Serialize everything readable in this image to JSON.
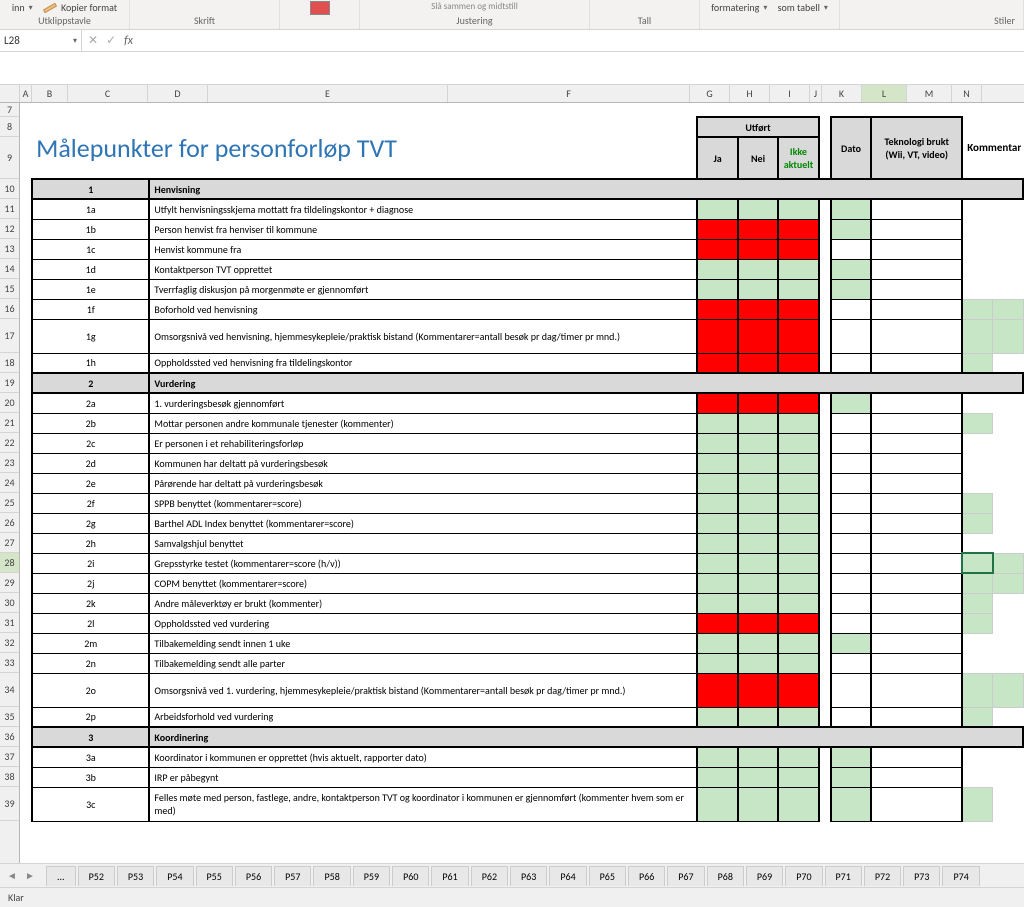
{
  "ribbon": {
    "copy_format": "Kopier format",
    "inn": "inn",
    "clipboard": "Utklippstavle",
    "font": "Skrift",
    "alignment": "Justering",
    "number": "Tall",
    "cond_format": "formatering",
    "as_table": "som tabell",
    "styles": "Stiler",
    "merge_center": "Slå sammen og midtstill"
  },
  "namebox": "L28",
  "columns": [
    "A",
    "B",
    "C",
    "D",
    "E",
    "F",
    "G",
    "H",
    "I",
    "J",
    "K",
    "L",
    "M",
    "N"
  ],
  "row_nums": [
    "7",
    "8",
    "9",
    "10",
    "11",
    "12",
    "13",
    "14",
    "15",
    "16",
    "17",
    "18",
    "19",
    "20",
    "21",
    "22",
    "23",
    "24",
    "25",
    "26",
    "27",
    "28",
    "29",
    "30",
    "31",
    "32",
    "33",
    "34",
    "35",
    "36",
    "37",
    "38",
    "39"
  ],
  "title": "Målepunkter for personforløp TVT",
  "headers": {
    "utfort": "Utført",
    "ja": "Ja",
    "nei": "Nei",
    "ikke": "Ikke aktuelt",
    "dato": "Dato",
    "teknologi": "Teknologi brukt (Wii, VT, video)",
    "kommentar": "Kommentar"
  },
  "sec1": {
    "num": "1",
    "title": "Henvisning"
  },
  "r1a": {
    "id": "1a",
    "txt": "Utfylt henvisningsskjema mottatt fra tildelingskontor + diagnose"
  },
  "r1b": {
    "id": "1b",
    "txt": "Person henvist fra henviser til kommune"
  },
  "r1c": {
    "id": "1c",
    "txt": "Henvist kommune fra"
  },
  "r1d": {
    "id": "1d",
    "txt": "Kontaktperson TVT opprettet"
  },
  "r1e": {
    "id": "1e",
    "txt": "Tverrfaglig diskusjon på morgenmøte er gjennomført"
  },
  "r1f": {
    "id": "1f",
    "txt": "Boforhold ved henvisning"
  },
  "r1g": {
    "id": "1g",
    "txt": "Omsorgsnivå ved henvisning, hjemmesykepleie/praktisk bistand (Kommentarer=antall besøk pr dag/timer pr mnd.)"
  },
  "r1h": {
    "id": "1h",
    "txt": "Oppholdssted ved henvisning fra tildelingskontor"
  },
  "sec2": {
    "num": "2",
    "title": "Vurdering"
  },
  "r2a": {
    "id": "2a",
    "txt": "1. vurderingsbesøk gjennomført"
  },
  "r2b": {
    "id": "2b",
    "txt": "Mottar personen andre kommunale tjenester (kommenter)"
  },
  "r2c": {
    "id": "2c",
    "txt": "Er personen i et rehabiliteringsforløp"
  },
  "r2d": {
    "id": "2d",
    "txt": "Kommunen har deltatt på vurderingsbesøk"
  },
  "r2e": {
    "id": "2e",
    "txt": "Pårørende har deltatt på vurderingsbesøk"
  },
  "r2f": {
    "id": "2f",
    "txt": "SPPB benyttet (kommentarer=score)"
  },
  "r2g": {
    "id": "2g",
    "txt": "Barthel ADL Index benyttet (kommentarer=score)"
  },
  "r2h": {
    "id": "2h",
    "txt": "Samvalgshjul benyttet"
  },
  "r2i": {
    "id": "2i",
    "txt": "Grepsstyrke testet (kommentarer=score (h/v))"
  },
  "r2j": {
    "id": "2j",
    "txt": "COPM benyttet (kommentarer=score)"
  },
  "r2k": {
    "id": "2k",
    "txt": "Andre måleverktøy er brukt (kommenter)"
  },
  "r2l": {
    "id": "2l",
    "txt": "Oppholdssted ved vurdering"
  },
  "r2m": {
    "id": "2m",
    "txt": "Tilbakemelding sendt innen 1 uke"
  },
  "r2n": {
    "id": "2n",
    "txt": "Tilbakemelding sendt alle parter"
  },
  "r2o": {
    "id": "2o",
    "txt": "Omsorgsnivå ved 1. vurdering, hjemmesykepleie/praktisk bistand (Kommentarer=antall besøk pr dag/timer pr mnd.)"
  },
  "r2p": {
    "id": "2p",
    "txt": "Arbeidsforhold ved vurdering"
  },
  "sec3": {
    "num": "3",
    "title": "Koordinering"
  },
  "r3a": {
    "id": "3a",
    "txt": "Koordinator i kommunen er opprettet (hvis aktuelt, rapporter dato)"
  },
  "r3b": {
    "id": "3b",
    "txt": "IRP er påbegynt"
  },
  "r3c": {
    "id": "3c",
    "txt": "Felles møte med person, fastlege, andre, kontaktperson TVT og koordinator i kommunen er gjennomført (kommenter hvem som er med)"
  },
  "tabs": [
    "P52",
    "P53",
    "P54",
    "P55",
    "P56",
    "P57",
    "P58",
    "P59",
    "P60",
    "P61",
    "P62",
    "P63",
    "P64",
    "P65",
    "P66",
    "P67",
    "P68",
    "P69",
    "P70",
    "P71",
    "P72",
    "P73",
    "P74"
  ],
  "status": "Klar",
  "dots": "..."
}
